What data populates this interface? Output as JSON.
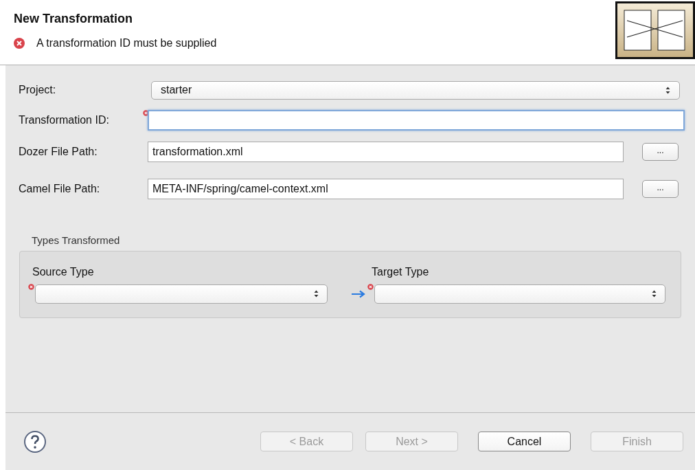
{
  "header": {
    "title": "New Transformation",
    "message": {
      "error": true,
      "text": "A transformation ID must be supplied"
    }
  },
  "fields": [
    {
      "kind": "select",
      "label": "Project:",
      "value": "starter",
      "error": false,
      "focused": false
    },
    {
      "kind": "text",
      "label": "Transformation ID:",
      "error": true,
      "focused": true
    },
    {
      "kind": "browse",
      "label": "Dozer File Path:",
      "value": "transformation.xml",
      "error": false,
      "focused": false,
      "button": "..."
    },
    {
      "kind": "browse",
      "label": "Camel File Path:",
      "value": "META-INF/spring/camel-context.xml",
      "error": false,
      "focused": false,
      "button": "..."
    }
  ],
  "types_group": {
    "title": "Types Transformed",
    "source": {
      "label": "Source Type",
      "error": true
    },
    "target": {
      "label": "Target Type",
      "error": true
    }
  },
  "buttons": [
    {
      "label": "< Back",
      "disabled": true
    },
    {
      "label": "Next >",
      "disabled": true
    },
    {
      "label": "Cancel",
      "disabled": false
    },
    {
      "label": "Finish",
      "disabled": true
    }
  ]
}
